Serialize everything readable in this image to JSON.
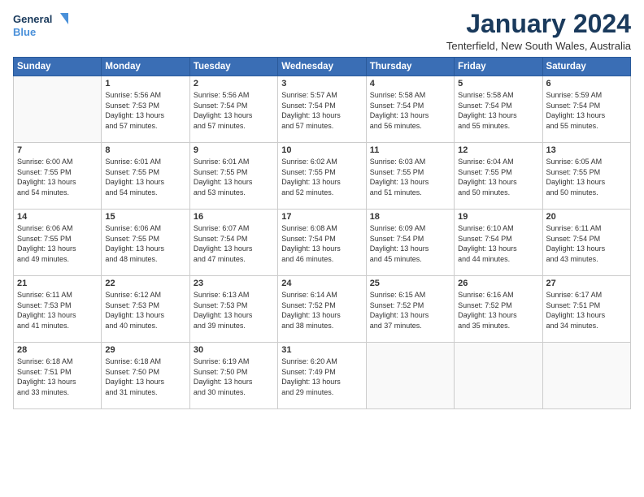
{
  "header": {
    "logo_line1": "General",
    "logo_line2": "Blue",
    "month": "January 2024",
    "location": "Tenterfield, New South Wales, Australia"
  },
  "days_of_week": [
    "Sunday",
    "Monday",
    "Tuesday",
    "Wednesday",
    "Thursday",
    "Friday",
    "Saturday"
  ],
  "weeks": [
    [
      {
        "day": "",
        "info": ""
      },
      {
        "day": "1",
        "info": "Sunrise: 5:56 AM\nSunset: 7:53 PM\nDaylight: 13 hours\nand 57 minutes."
      },
      {
        "day": "2",
        "info": "Sunrise: 5:56 AM\nSunset: 7:54 PM\nDaylight: 13 hours\nand 57 minutes."
      },
      {
        "day": "3",
        "info": "Sunrise: 5:57 AM\nSunset: 7:54 PM\nDaylight: 13 hours\nand 57 minutes."
      },
      {
        "day": "4",
        "info": "Sunrise: 5:58 AM\nSunset: 7:54 PM\nDaylight: 13 hours\nand 56 minutes."
      },
      {
        "day": "5",
        "info": "Sunrise: 5:58 AM\nSunset: 7:54 PM\nDaylight: 13 hours\nand 55 minutes."
      },
      {
        "day": "6",
        "info": "Sunrise: 5:59 AM\nSunset: 7:54 PM\nDaylight: 13 hours\nand 55 minutes."
      }
    ],
    [
      {
        "day": "7",
        "info": "Sunrise: 6:00 AM\nSunset: 7:55 PM\nDaylight: 13 hours\nand 54 minutes."
      },
      {
        "day": "8",
        "info": "Sunrise: 6:01 AM\nSunset: 7:55 PM\nDaylight: 13 hours\nand 54 minutes."
      },
      {
        "day": "9",
        "info": "Sunrise: 6:01 AM\nSunset: 7:55 PM\nDaylight: 13 hours\nand 53 minutes."
      },
      {
        "day": "10",
        "info": "Sunrise: 6:02 AM\nSunset: 7:55 PM\nDaylight: 13 hours\nand 52 minutes."
      },
      {
        "day": "11",
        "info": "Sunrise: 6:03 AM\nSunset: 7:55 PM\nDaylight: 13 hours\nand 51 minutes."
      },
      {
        "day": "12",
        "info": "Sunrise: 6:04 AM\nSunset: 7:55 PM\nDaylight: 13 hours\nand 50 minutes."
      },
      {
        "day": "13",
        "info": "Sunrise: 6:05 AM\nSunset: 7:55 PM\nDaylight: 13 hours\nand 50 minutes."
      }
    ],
    [
      {
        "day": "14",
        "info": "Sunrise: 6:06 AM\nSunset: 7:55 PM\nDaylight: 13 hours\nand 49 minutes."
      },
      {
        "day": "15",
        "info": "Sunrise: 6:06 AM\nSunset: 7:55 PM\nDaylight: 13 hours\nand 48 minutes."
      },
      {
        "day": "16",
        "info": "Sunrise: 6:07 AM\nSunset: 7:54 PM\nDaylight: 13 hours\nand 47 minutes."
      },
      {
        "day": "17",
        "info": "Sunrise: 6:08 AM\nSunset: 7:54 PM\nDaylight: 13 hours\nand 46 minutes."
      },
      {
        "day": "18",
        "info": "Sunrise: 6:09 AM\nSunset: 7:54 PM\nDaylight: 13 hours\nand 45 minutes."
      },
      {
        "day": "19",
        "info": "Sunrise: 6:10 AM\nSunset: 7:54 PM\nDaylight: 13 hours\nand 44 minutes."
      },
      {
        "day": "20",
        "info": "Sunrise: 6:11 AM\nSunset: 7:54 PM\nDaylight: 13 hours\nand 43 minutes."
      }
    ],
    [
      {
        "day": "21",
        "info": "Sunrise: 6:11 AM\nSunset: 7:53 PM\nDaylight: 13 hours\nand 41 minutes."
      },
      {
        "day": "22",
        "info": "Sunrise: 6:12 AM\nSunset: 7:53 PM\nDaylight: 13 hours\nand 40 minutes."
      },
      {
        "day": "23",
        "info": "Sunrise: 6:13 AM\nSunset: 7:53 PM\nDaylight: 13 hours\nand 39 minutes."
      },
      {
        "day": "24",
        "info": "Sunrise: 6:14 AM\nSunset: 7:52 PM\nDaylight: 13 hours\nand 38 minutes."
      },
      {
        "day": "25",
        "info": "Sunrise: 6:15 AM\nSunset: 7:52 PM\nDaylight: 13 hours\nand 37 minutes."
      },
      {
        "day": "26",
        "info": "Sunrise: 6:16 AM\nSunset: 7:52 PM\nDaylight: 13 hours\nand 35 minutes."
      },
      {
        "day": "27",
        "info": "Sunrise: 6:17 AM\nSunset: 7:51 PM\nDaylight: 13 hours\nand 34 minutes."
      }
    ],
    [
      {
        "day": "28",
        "info": "Sunrise: 6:18 AM\nSunset: 7:51 PM\nDaylight: 13 hours\nand 33 minutes."
      },
      {
        "day": "29",
        "info": "Sunrise: 6:18 AM\nSunset: 7:50 PM\nDaylight: 13 hours\nand 31 minutes."
      },
      {
        "day": "30",
        "info": "Sunrise: 6:19 AM\nSunset: 7:50 PM\nDaylight: 13 hours\nand 30 minutes."
      },
      {
        "day": "31",
        "info": "Sunrise: 6:20 AM\nSunset: 7:49 PM\nDaylight: 13 hours\nand 29 minutes."
      },
      {
        "day": "",
        "info": ""
      },
      {
        "day": "",
        "info": ""
      },
      {
        "day": "",
        "info": ""
      }
    ]
  ]
}
